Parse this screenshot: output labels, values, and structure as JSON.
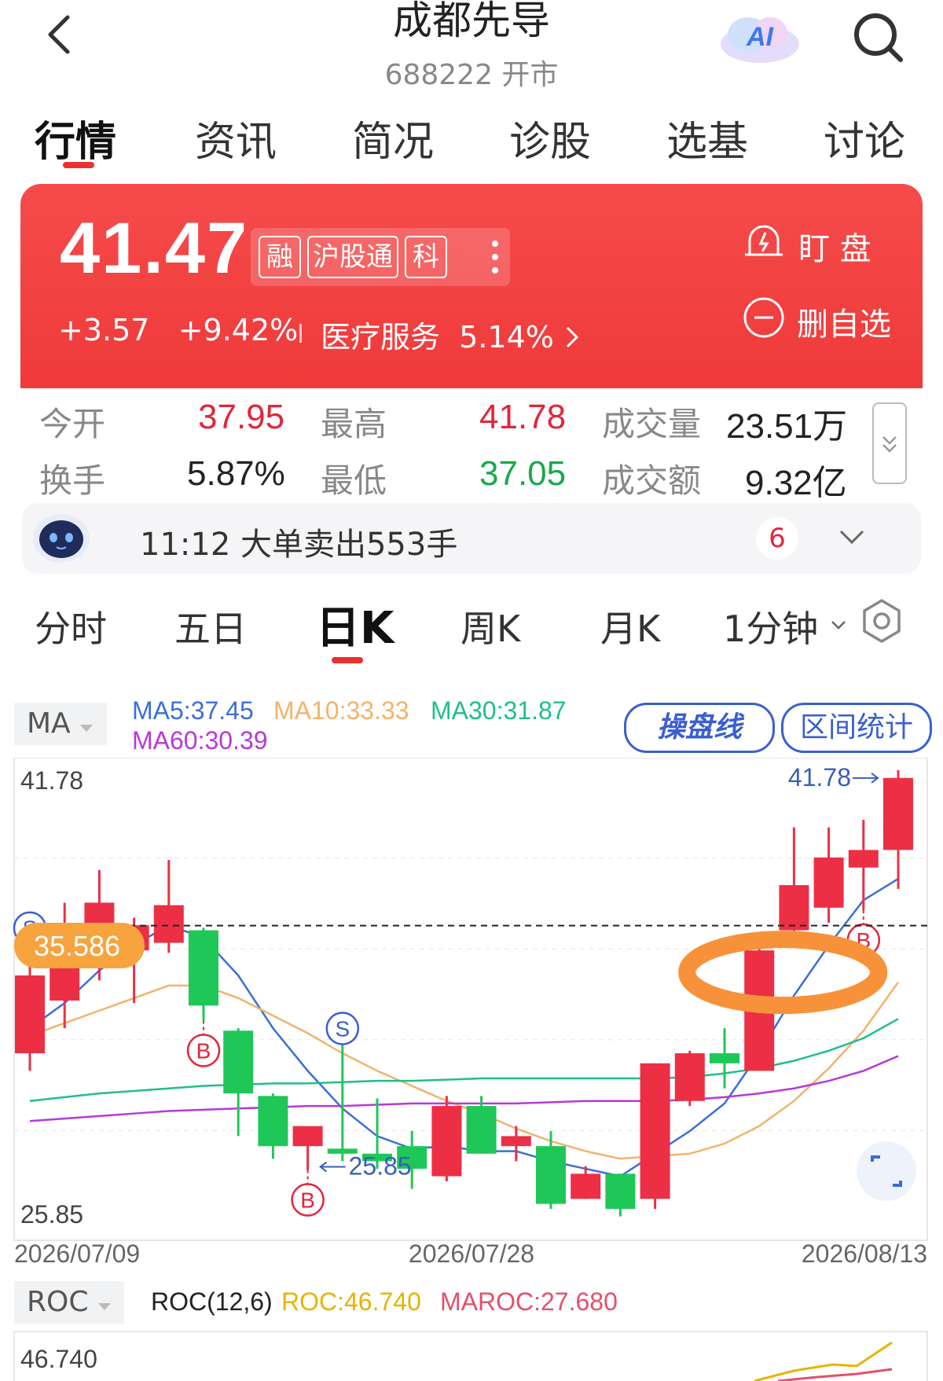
{
  "header": {
    "title": "成都先导",
    "subtitle": "688222 开市",
    "ai_label": "AI"
  },
  "tabs": [
    {
      "label": "行情"
    },
    {
      "label": "资讯"
    },
    {
      "label": "简况"
    },
    {
      "label": "诊股"
    },
    {
      "label": "选基"
    },
    {
      "label": "讨论"
    }
  ],
  "quote": {
    "price": "41.47",
    "badges": [
      "融",
      "沪股通",
      "科"
    ],
    "change": "+3.57",
    "change_pct": "+9.42%",
    "sector": "医疗服务",
    "sector_pct": "5.14%",
    "watch_label": "盯 盘",
    "remove_label": "删自选"
  },
  "stats": {
    "open_label": "今开",
    "open": "37.95",
    "high_label": "最高",
    "high": "41.78",
    "volume_label": "成交量",
    "volume": "23.51万",
    "turnover_label": "换手",
    "turnover": "5.87%",
    "low_label": "最低",
    "low": "37.05",
    "amount_label": "成交额",
    "amount": "9.32亿"
  },
  "news": {
    "text": "11:12 大单卖出553手",
    "count": "6"
  },
  "period_tabs": [
    {
      "label": "分时"
    },
    {
      "label": "五日"
    },
    {
      "label": "日K"
    },
    {
      "label": "周K"
    },
    {
      "label": "月K"
    },
    {
      "label": "1分钟"
    }
  ],
  "ma_panel": {
    "selector": "MA",
    "ma5": "MA5:37.45",
    "ma10": "MA10:33.33",
    "ma30": "MA30:31.87",
    "ma60": "MA60:30.39",
    "caopan_label": "操盘线",
    "qujian_label": "区间统计",
    "colors": {
      "ma5": "#3b6fd6",
      "ma10": "#f2b36b",
      "ma30": "#1fbf8a",
      "ma60": "#b63ad6",
      "up": "#ec2f45",
      "down": "#1ec758"
    }
  },
  "chart_data": {
    "type": "candlestick",
    "y_max_label": "41.78",
    "y_min_label": "25.85",
    "current_line_label": "35.586",
    "high_marker": "41.78",
    "low_marker": "25.85",
    "x_labels": [
      "2026/07/09",
      "2026/07/28",
      "2026/08/13"
    ],
    "candles": [
      {
        "o": 30.5,
        "h": 34.8,
        "l": 29.8,
        "c": 33.6
      },
      {
        "o": 32.6,
        "h": 36.5,
        "l": 31.5,
        "c": 35.3
      },
      {
        "o": 34.5,
        "h": 37.8,
        "l": 33.4,
        "c": 36.5
      },
      {
        "o": 34.6,
        "h": 35.9,
        "l": 32.5,
        "c": 35.6
      },
      {
        "o": 34.9,
        "h": 38.2,
        "l": 34.5,
        "c": 36.4
      },
      {
        "o": 35.4,
        "h": 35.5,
        "l": 31.8,
        "c": 32.4
      },
      {
        "o": 31.4,
        "h": 31.5,
        "l": 27.2,
        "c": 28.9
      },
      {
        "o": 28.8,
        "h": 28.9,
        "l": 26.3,
        "c": 26.8
      },
      {
        "o": 26.8,
        "h": 27.4,
        "l": 25.85,
        "c": 27.6
      },
      {
        "o": 26.7,
        "h": 30.8,
        "l": 26.2,
        "c": 26.5
      },
      {
        "o": 26.5,
        "h": 28.7,
        "l": 25.9,
        "c": 26.2
      },
      {
        "o": 26.8,
        "h": 27.4,
        "l": 25.1,
        "c": 25.9
      },
      {
        "o": 25.6,
        "h": 28.8,
        "l": 25.4,
        "c": 28.4
      },
      {
        "o": 28.4,
        "h": 28.8,
        "l": 26.5,
        "c": 26.5
      },
      {
        "o": 26.8,
        "h": 27.6,
        "l": 26.2,
        "c": 27.2
      },
      {
        "o": 26.8,
        "h": 27.4,
        "l": 24.3,
        "c": 24.5
      },
      {
        "o": 24.7,
        "h": 26.0,
        "l": 24.7,
        "c": 25.7
      },
      {
        "o": 25.7,
        "h": 25.7,
        "l": 24.0,
        "c": 24.3
      },
      {
        "o": 24.7,
        "h": 30.1,
        "l": 24.3,
        "c": 30.1
      },
      {
        "o": 28.6,
        "h": 30.6,
        "l": 28.4,
        "c": 30.5
      },
      {
        "o": 30.5,
        "h": 31.5,
        "l": 29.1,
        "c": 30.1
      },
      {
        "o": 29.8,
        "h": 34.8,
        "l": 29.8,
        "c": 34.6
      },
      {
        "o": 35.4,
        "h": 39.5,
        "l": 35.3,
        "c": 37.2
      },
      {
        "o": 36.3,
        "h": 39.5,
        "l": 35.7,
        "c": 38.3
      },
      {
        "o": 37.9,
        "h": 39.8,
        "l": 36.2,
        "c": 38.6
      },
      {
        "o": 38.6,
        "h": 41.78,
        "l": 37.05,
        "c": 41.47
      }
    ],
    "series": [
      {
        "name": "MA5",
        "values": [
          31.5,
          32.5,
          33.8,
          34.8,
          35.6,
          35.1,
          33.6,
          31.5,
          29.8,
          28.3,
          27.2,
          26.7,
          26.8,
          26.6,
          26.6,
          26.2,
          25.9,
          25.6,
          26.5,
          27.4,
          28.5,
          30.5,
          32.8,
          34.8,
          36.6,
          37.45
        ]
      },
      {
        "name": "MA10",
        "values": [
          31.2,
          31.7,
          32.2,
          32.7,
          33.2,
          33.2,
          32.7,
          32.0,
          31.3,
          30.5,
          29.8,
          29.2,
          28.6,
          28.1,
          27.5,
          27.0,
          26.6,
          26.3,
          26.4,
          26.5,
          26.9,
          27.6,
          28.6,
          29.9,
          31.4,
          33.33
        ]
      },
      {
        "name": "MA30",
        "values": [
          28.6,
          28.75,
          28.9,
          29.0,
          29.1,
          29.2,
          29.25,
          29.3,
          29.3,
          29.35,
          29.4,
          29.4,
          29.45,
          29.5,
          29.5,
          29.5,
          29.5,
          29.5,
          29.5,
          29.55,
          29.7,
          29.9,
          30.2,
          30.6,
          31.1,
          31.87
        ]
      },
      {
        "name": "MA60",
        "values": [
          27.8,
          27.9,
          28.0,
          28.1,
          28.2,
          28.25,
          28.3,
          28.35,
          28.4,
          28.4,
          28.45,
          28.5,
          28.5,
          28.5,
          28.5,
          28.55,
          28.6,
          28.6,
          28.6,
          28.65,
          28.75,
          28.9,
          29.1,
          29.4,
          29.8,
          30.39
        ]
      }
    ],
    "signals": [
      {
        "label": "S",
        "index": 0,
        "kind": "sell"
      },
      {
        "label": "B",
        "index": 5,
        "kind": "buy"
      },
      {
        "label": "B",
        "index": 8,
        "kind": "buy"
      },
      {
        "label": "S",
        "index": 9,
        "kind": "sell"
      },
      {
        "label": "B",
        "index": 24,
        "kind": "buy"
      }
    ],
    "highlight_index": 21
  },
  "roc_panel": {
    "selector": "ROC",
    "params": "ROC(12,6)",
    "roc": "ROC:46.740",
    "maroc": "MAROC:27.680",
    "top_value": "46.740",
    "colors": {
      "roc": "#e5b400",
      "maroc": "#e3506b"
    }
  }
}
